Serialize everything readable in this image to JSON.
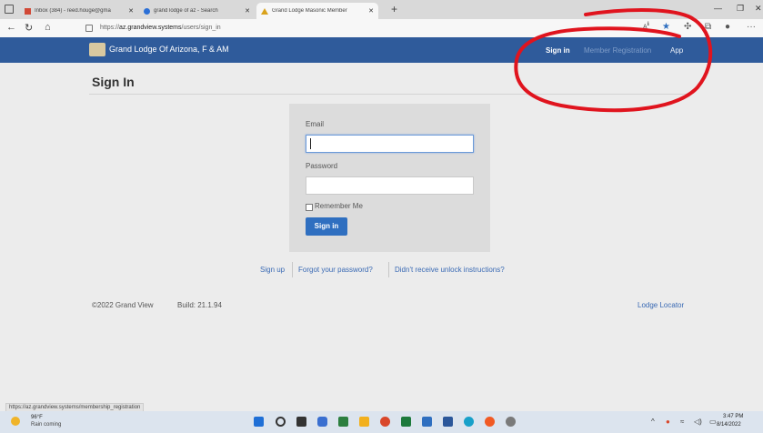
{
  "browser": {
    "tabs": [
      {
        "label": "Inbox (384) - reed.houge@gma",
        "favicon_color": "#d14836"
      },
      {
        "label": "grand lodge of az - Search",
        "favicon_color": "#2b6fd6"
      },
      {
        "label": "Grand Lodge Masonic Member",
        "favicon_color": "#d9a21b"
      }
    ],
    "url_prefix": "https://",
    "url_host": "az.grandview.systems",
    "url_path": "/users/sign_in",
    "status_url": "https://az.grandview.systems/membership_registration"
  },
  "navbar": {
    "brand": "Grand Lodge Of Arizona, F & AM",
    "links": {
      "sign_in": "Sign in",
      "member_registration": "Member Registration",
      "app": "App"
    },
    "colors": {
      "bar": "#2f5b9b",
      "active": "#ffffff",
      "muted": "#7e9cc8"
    }
  },
  "page": {
    "title": "Sign In",
    "form": {
      "email_label": "Email",
      "email_value": "",
      "password_label": "Password",
      "password_value": "",
      "remember_label": "Remember Me",
      "remember_checked": false,
      "submit_label": "Sign in"
    },
    "links": {
      "sign_up": "Sign up",
      "forgot": "Forgot your password?",
      "unlock": "Didn't receive unlock instructions?"
    },
    "footer": {
      "copyright": "©2022 Grand View",
      "build": "Build: 21.1.94",
      "lodge_locator": "Lodge Locator"
    }
  },
  "taskbar": {
    "temperature": "96°F",
    "condition": "Rain coming",
    "time": "3:47 PM",
    "date": "8/14/2022"
  },
  "annotation_color": "#e0141e"
}
